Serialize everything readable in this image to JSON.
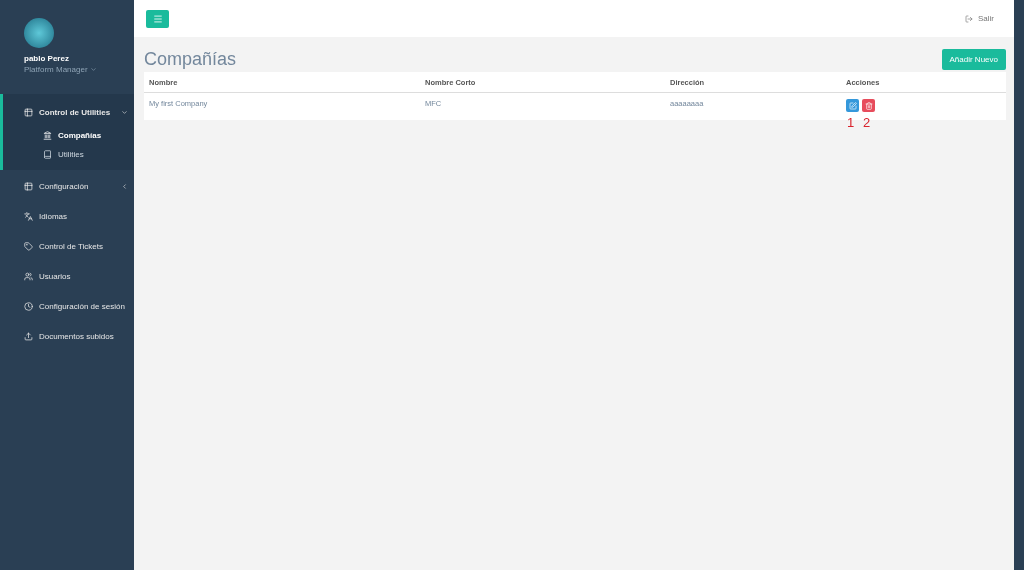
{
  "profile": {
    "name": "pablo Perez",
    "role": "Platform Manager"
  },
  "sidebar": {
    "items": [
      {
        "label": "Control de Utilities",
        "expanded": true,
        "has_children": true,
        "children": [
          {
            "label": "Compañías",
            "selected": true
          },
          {
            "label": "Utilities",
            "selected": false
          }
        ]
      },
      {
        "label": "Configuración",
        "expanded": false,
        "has_children": true
      },
      {
        "label": "Idiomas",
        "expanded": false,
        "has_children": false
      },
      {
        "label": "Control de Tickets",
        "expanded": false,
        "has_children": false
      },
      {
        "label": "Usuarios",
        "expanded": false,
        "has_children": false
      },
      {
        "label": "Configuración de sesión",
        "expanded": false,
        "has_children": false
      },
      {
        "label": "Documentos subidos",
        "expanded": false,
        "has_children": false
      }
    ]
  },
  "topbar": {
    "logout": "Salir"
  },
  "page": {
    "title": "Compañías",
    "add_button": "Añadir Nuevo"
  },
  "table": {
    "columns": [
      "Nombre",
      "Nombre Corto",
      "Dirección",
      "Acciones"
    ],
    "rows": [
      {
        "cells": [
          "My first Company",
          "MFC",
          "aaaaaaaa"
        ],
        "actions": [
          {
            "kind": "edit",
            "note": "1"
          },
          {
            "kind": "delete",
            "note": "2"
          }
        ]
      }
    ]
  }
}
